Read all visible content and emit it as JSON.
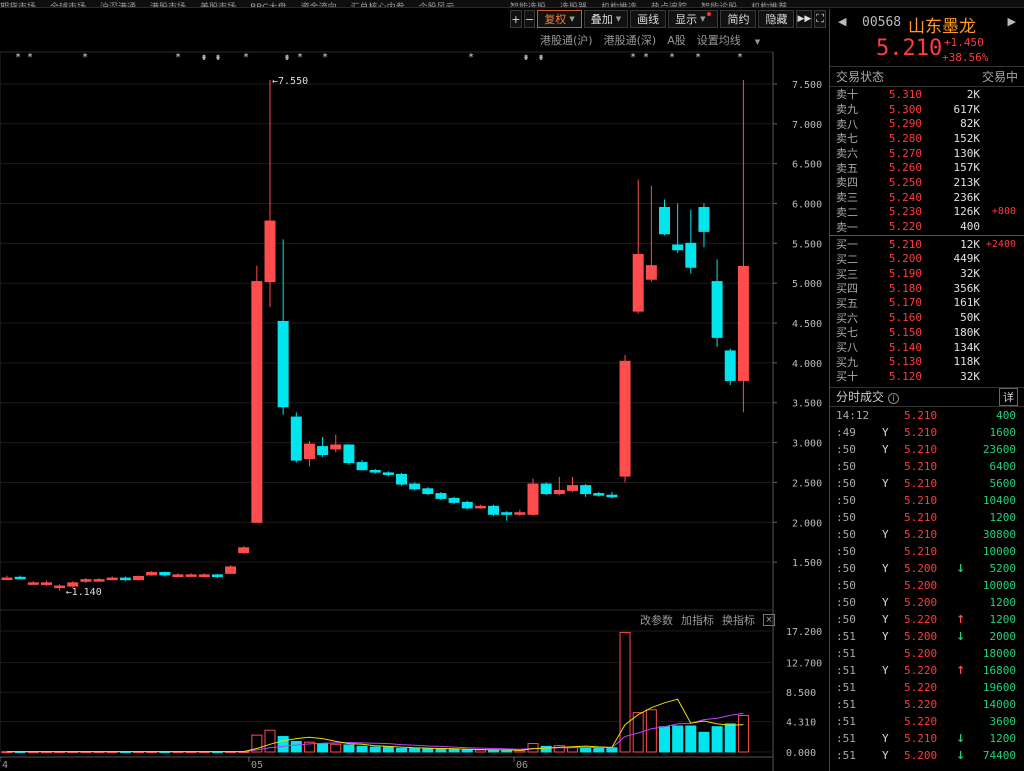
{
  "topnav": {
    "left_items": [
      "期货市场",
      "全球市场",
      "沪深港通",
      "港股市场",
      "美股市场",
      "BBC大盘",
      "资金流向",
      "汇总核心内参",
      "个股风云",
      "分析特色指数",
      "涨停选股"
    ],
    "right_items": [
      "智能选股",
      "选股器",
      "机构推选",
      "热点追踪",
      "智能诊股",
      "机构推荐"
    ]
  },
  "toolbar": {
    "plus": "+",
    "minus": "−",
    "fuquan": "复权",
    "overlay": "叠加",
    "draw": "画线",
    "display": "显示",
    "simple": "简约",
    "hide": "隐藏",
    "play": "▶▶",
    "fullscreen": "⛶"
  },
  "sub_toolbar": {
    "sh_connect": "港股通(沪)",
    "sz_connect": "港股通(深)",
    "a_share": "A股",
    "ma_setting": "设置均线"
  },
  "ind_toolbar": {
    "params": "改参数",
    "add": "加指标",
    "switch": "换指标",
    "close": "×"
  },
  "annotations": {
    "high": "7.550",
    "low": "1.140"
  },
  "chart_data": {
    "type": "candlestick",
    "y_ticks": [
      "7.500",
      "7.000",
      "6.500",
      "6.000",
      "5.500",
      "5.000",
      "4.500",
      "4.000",
      "3.500",
      "3.000",
      "2.500",
      "2.000",
      "1.500"
    ],
    "vol_ticks": [
      "17.200",
      "12.700",
      "8.500",
      "4.310",
      "0.000"
    ],
    "x_labels": [
      "4",
      "05",
      "06"
    ],
    "ylim": [
      1.05,
      7.65
    ],
    "high": 7.55,
    "low": 1.14,
    "candles": [
      {
        "o": 1.3,
        "c": 1.3,
        "h": 1.33,
        "l": 1.28
      },
      {
        "o": 1.31,
        "c": 1.3,
        "h": 1.33,
        "l": 1.29
      },
      {
        "o": 1.24,
        "c": 1.24,
        "h": 1.26,
        "l": 1.22
      },
      {
        "o": 1.22,
        "c": 1.24,
        "h": 1.27,
        "l": 1.2
      },
      {
        "o": 1.18,
        "c": 1.2,
        "h": 1.22,
        "l": 1.14
      },
      {
        "o": 1.2,
        "c": 1.24,
        "h": 1.26,
        "l": 1.18
      },
      {
        "o": 1.26,
        "c": 1.28,
        "h": 1.3,
        "l": 1.24
      },
      {
        "o": 1.28,
        "c": 1.28,
        "h": 1.3,
        "l": 1.26
      },
      {
        "o": 1.28,
        "c": 1.3,
        "h": 1.32,
        "l": 1.27
      },
      {
        "o": 1.3,
        "c": 1.28,
        "h": 1.32,
        "l": 1.26
      },
      {
        "o": 1.28,
        "c": 1.32,
        "h": 1.33,
        "l": 1.27
      },
      {
        "o": 1.34,
        "c": 1.37,
        "h": 1.39,
        "l": 1.33
      },
      {
        "o": 1.37,
        "c": 1.34,
        "h": 1.38,
        "l": 1.32
      },
      {
        "o": 1.32,
        "c": 1.34,
        "h": 1.36,
        "l": 1.31
      },
      {
        "o": 1.34,
        "c": 1.34,
        "h": 1.36,
        "l": 1.32
      },
      {
        "o": 1.32,
        "c": 1.34,
        "h": 1.36,
        "l": 1.31
      },
      {
        "o": 1.34,
        "c": 1.32,
        "h": 1.35,
        "l": 1.3
      },
      {
        "o": 1.36,
        "c": 1.44,
        "h": 1.46,
        "l": 1.35
      },
      {
        "o": 1.62,
        "c": 1.68,
        "h": 1.7,
        "l": 1.6
      },
      {
        "o": 2.0,
        "c": 5.02,
        "h": 5.22,
        "l": 2.0
      },
      {
        "o": 5.02,
        "c": 5.78,
        "h": 7.55,
        "l": 4.7
      },
      {
        "o": 4.52,
        "c": 3.45,
        "h": 5.55,
        "l": 3.35
      },
      {
        "o": 3.32,
        "c": 2.78,
        "h": 3.38,
        "l": 2.75
      },
      {
        "o": 2.8,
        "c": 2.98,
        "h": 3.02,
        "l": 2.7
      },
      {
        "o": 2.95,
        "c": 2.85,
        "h": 3.07,
        "l": 2.82
      },
      {
        "o": 2.92,
        "c": 2.97,
        "h": 3.1,
        "l": 2.88
      },
      {
        "o": 2.97,
        "c": 2.75,
        "h": 2.98,
        "l": 2.72
      },
      {
        "o": 2.75,
        "c": 2.66,
        "h": 2.78,
        "l": 2.65
      },
      {
        "o": 2.65,
        "c": 2.63,
        "h": 2.67,
        "l": 2.61
      },
      {
        "o": 2.62,
        "c": 2.6,
        "h": 2.64,
        "l": 2.58
      },
      {
        "o": 2.6,
        "c": 2.48,
        "h": 2.62,
        "l": 2.46
      },
      {
        "o": 2.48,
        "c": 2.42,
        "h": 2.5,
        "l": 2.4
      },
      {
        "o": 2.42,
        "c": 2.36,
        "h": 2.44,
        "l": 2.34
      },
      {
        "o": 2.36,
        "c": 2.3,
        "h": 2.38,
        "l": 2.28
      },
      {
        "o": 2.3,
        "c": 2.25,
        "h": 2.32,
        "l": 2.23
      },
      {
        "o": 2.25,
        "c": 2.18,
        "h": 2.27,
        "l": 2.16
      },
      {
        "o": 2.18,
        "c": 2.2,
        "h": 2.22,
        "l": 2.17
      },
      {
        "o": 2.2,
        "c": 2.1,
        "h": 2.22,
        "l": 2.08
      },
      {
        "o": 2.12,
        "c": 2.1,
        "h": 2.14,
        "l": 2.02
      },
      {
        "o": 2.1,
        "c": 2.12,
        "h": 2.16,
        "l": 2.08
      },
      {
        "o": 2.1,
        "c": 2.48,
        "h": 2.55,
        "l": 2.08
      },
      {
        "o": 2.48,
        "c": 2.36,
        "h": 2.5,
        "l": 2.34
      },
      {
        "o": 2.36,
        "c": 2.4,
        "h": 2.57,
        "l": 2.34
      },
      {
        "o": 2.4,
        "c": 2.46,
        "h": 2.57,
        "l": 2.38
      },
      {
        "o": 2.46,
        "c": 2.36,
        "h": 2.48,
        "l": 2.32
      },
      {
        "o": 2.36,
        "c": 2.34,
        "h": 2.38,
        "l": 2.32
      },
      {
        "o": 2.34,
        "c": 2.32,
        "h": 2.38,
        "l": 2.3
      },
      {
        "o": 2.58,
        "c": 4.02,
        "h": 4.1,
        "l": 2.5
      },
      {
        "o": 4.65,
        "c": 5.36,
        "h": 6.3,
        "l": 4.62
      },
      {
        "o": 5.05,
        "c": 5.22,
        "h": 6.22,
        "l": 5.02
      },
      {
        "o": 5.95,
        "c": 5.62,
        "h": 6.05,
        "l": 5.6
      },
      {
        "o": 5.48,
        "c": 5.42,
        "h": 6.0,
        "l": 5.38
      },
      {
        "o": 5.5,
        "c": 5.2,
        "h": 5.92,
        "l": 5.12
      },
      {
        "o": 5.95,
        "c": 5.65,
        "h": 6.0,
        "l": 5.45
      },
      {
        "o": 5.02,
        "c": 4.32,
        "h": 5.3,
        "l": 4.2
      },
      {
        "o": 4.15,
        "c": 3.78,
        "h": 4.18,
        "l": 3.72
      },
      {
        "o": 3.78,
        "c": 5.21,
        "h": 7.55,
        "l": 3.38
      }
    ],
    "volumes": [
      0.05,
      0.05,
      0.04,
      0.04,
      0.05,
      0.06,
      0.05,
      0.05,
      0.05,
      0.05,
      0.05,
      0.06,
      0.05,
      0.05,
      0.05,
      0.05,
      0.05,
      0.06,
      0.08,
      2.4,
      3.1,
      2.2,
      1.5,
      1.4,
      1.2,
      1.1,
      1.0,
      0.8,
      0.7,
      0.7,
      0.5,
      0.5,
      0.5,
      0.4,
      0.4,
      0.3,
      0.3,
      0.3,
      0.2,
      0.2,
      1.2,
      0.8,
      0.9,
      0.7,
      0.6,
      0.6,
      0.6,
      17.0,
      5.6,
      6.0,
      3.6,
      3.7,
      3.7,
      2.8,
      3.6,
      4.0,
      5.2
    ],
    "vol_ma5": [
      0.05,
      0.05,
      0.05,
      0.05,
      0.05,
      0.05,
      0.05,
      0.05,
      0.05,
      0.05,
      0.05,
      0.05,
      0.05,
      0.05,
      0.05,
      0.05,
      0.05,
      0.05,
      0.06,
      0.5,
      1.1,
      1.6,
      1.9,
      2.1,
      1.9,
      1.5,
      1.2,
      1.1,
      0.9,
      0.8,
      0.7,
      0.6,
      0.55,
      0.5,
      0.45,
      0.4,
      0.35,
      0.3,
      0.3,
      0.25,
      0.45,
      0.55,
      0.65,
      0.76,
      0.84,
      0.72,
      0.66,
      3.9,
      5.3,
      6.3,
      7.0,
      7.5,
      4.1,
      4.4,
      4.0,
      3.8,
      3.9
    ],
    "vol_ma10": [
      0.05,
      0.05,
      0.05,
      0.05,
      0.05,
      0.05,
      0.05,
      0.05,
      0.05,
      0.05,
      0.05,
      0.05,
      0.05,
      0.05,
      0.05,
      0.05,
      0.05,
      0.05,
      0.05,
      0.3,
      0.6,
      0.8,
      1.0,
      1.15,
      1.25,
      1.3,
      1.35,
      1.3,
      1.25,
      1.2,
      1.05,
      0.95,
      0.85,
      0.8,
      0.7,
      0.6,
      0.55,
      0.5,
      0.45,
      0.4,
      0.5,
      0.55,
      0.6,
      0.6,
      0.65,
      0.62,
      0.6,
      2.2,
      2.7,
      3.3,
      3.6,
      4.0,
      4.1,
      4.6,
      4.8,
      5.2,
      5.5
    ]
  },
  "stock": {
    "nav_left": "◀",
    "nav_right": "▶",
    "code": "00568",
    "name": "山东墨龙",
    "price": "5.210",
    "change": "+1.450",
    "change_pct": "+38.56%"
  },
  "status": {
    "label": "交易状态",
    "value": "交易中"
  },
  "asks": [
    {
      "label": "卖十",
      "price": "5.310",
      "vol": "2K",
      "chg": ""
    },
    {
      "label": "卖九",
      "price": "5.300",
      "vol": "617K",
      "chg": ""
    },
    {
      "label": "卖八",
      "price": "5.290",
      "vol": "82K",
      "chg": ""
    },
    {
      "label": "卖七",
      "price": "5.280",
      "vol": "152K",
      "chg": ""
    },
    {
      "label": "卖六",
      "price": "5.270",
      "vol": "130K",
      "chg": ""
    },
    {
      "label": "卖五",
      "price": "5.260",
      "vol": "157K",
      "chg": ""
    },
    {
      "label": "卖四",
      "price": "5.250",
      "vol": "213K",
      "chg": ""
    },
    {
      "label": "卖三",
      "price": "5.240",
      "vol": "236K",
      "chg": ""
    },
    {
      "label": "卖二",
      "price": "5.230",
      "vol": "126K",
      "chg": "+800"
    },
    {
      "label": "卖一",
      "price": "5.220",
      "vol": "400",
      "chg": ""
    }
  ],
  "bids": [
    {
      "label": "买一",
      "price": "5.210",
      "vol": "12K",
      "chg": "+2400"
    },
    {
      "label": "买二",
      "price": "5.200",
      "vol": "449K",
      "chg": ""
    },
    {
      "label": "买三",
      "price": "5.190",
      "vol": "32K",
      "chg": ""
    },
    {
      "label": "买四",
      "price": "5.180",
      "vol": "356K",
      "chg": ""
    },
    {
      "label": "买五",
      "price": "5.170",
      "vol": "161K",
      "chg": ""
    },
    {
      "label": "买六",
      "price": "5.160",
      "vol": "50K",
      "chg": ""
    },
    {
      "label": "买七",
      "price": "5.150",
      "vol": "180K",
      "chg": ""
    },
    {
      "label": "买八",
      "price": "5.140",
      "vol": "134K",
      "chg": ""
    },
    {
      "label": "买九",
      "price": "5.130",
      "vol": "118K",
      "chg": ""
    },
    {
      "label": "买十",
      "price": "5.120",
      "vol": "32K",
      "chg": ""
    }
  ],
  "trades_panel": {
    "title": "分时成交",
    "info": "i",
    "detail": "详"
  },
  "trades": [
    {
      "time": "14:12",
      "y": "",
      "price": "5.210",
      "arrow": "",
      "vol": "400"
    },
    {
      "time": ":49",
      "y": "Y",
      "price": "5.210",
      "arrow": "",
      "vol": "1600"
    },
    {
      "time": ":50",
      "y": "Y",
      "price": "5.210",
      "arrow": "",
      "vol": "23600"
    },
    {
      "time": ":50",
      "y": "",
      "price": "5.210",
      "arrow": "",
      "vol": "6400"
    },
    {
      "time": ":50",
      "y": "Y",
      "price": "5.210",
      "arrow": "",
      "vol": "5600"
    },
    {
      "time": ":50",
      "y": "",
      "price": "5.210",
      "arrow": "",
      "vol": "10400"
    },
    {
      "time": ":50",
      "y": "",
      "price": "5.210",
      "arrow": "",
      "vol": "1200"
    },
    {
      "time": ":50",
      "y": "Y",
      "price": "5.210",
      "arrow": "",
      "vol": "30800"
    },
    {
      "time": ":50",
      "y": "",
      "price": "5.210",
      "arrow": "",
      "vol": "10000"
    },
    {
      "time": ":50",
      "y": "Y",
      "price": "5.200",
      "arrow": "down",
      "vol": "5200"
    },
    {
      "time": ":50",
      "y": "",
      "price": "5.200",
      "arrow": "",
      "vol": "10000"
    },
    {
      "time": ":50",
      "y": "Y",
      "price": "5.200",
      "arrow": "",
      "vol": "1200"
    },
    {
      "time": ":50",
      "y": "Y",
      "price": "5.220",
      "arrow": "up",
      "vol": "1200"
    },
    {
      "time": ":51",
      "y": "Y",
      "price": "5.200",
      "arrow": "down",
      "vol": "2000"
    },
    {
      "time": ":51",
      "y": "",
      "price": "5.200",
      "arrow": "",
      "vol": "18000"
    },
    {
      "time": ":51",
      "y": "Y",
      "price": "5.220",
      "arrow": "up",
      "vol": "16800"
    },
    {
      "time": ":51",
      "y": "",
      "price": "5.220",
      "arrow": "",
      "vol": "19600"
    },
    {
      "time": ":51",
      "y": "",
      "price": "5.220",
      "arrow": "",
      "vol": "14000"
    },
    {
      "time": ":51",
      "y": "",
      "price": "5.220",
      "arrow": "",
      "vol": "3600"
    },
    {
      "time": ":51",
      "y": "Y",
      "price": "5.210",
      "arrow": "down",
      "vol": "1200"
    },
    {
      "time": ":51",
      "y": "Y",
      "price": "5.200",
      "arrow": "down",
      "vol": "74400"
    }
  ],
  "colors": {
    "up": "#ff4d4d",
    "down": "#00e5ee",
    "ma5": "#e8e000",
    "ma10": "#c040ff",
    "grid": "#1b1b1b"
  }
}
